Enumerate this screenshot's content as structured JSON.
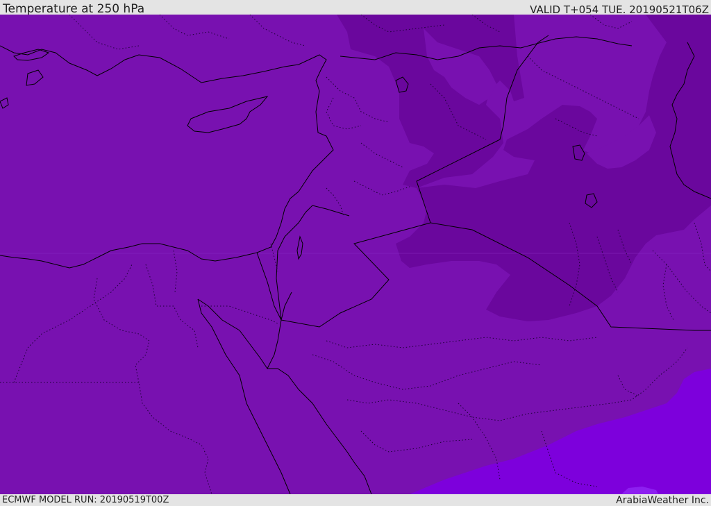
{
  "header": {
    "title": "Temperature at 250 hPa",
    "valid_time": "VALID T+054 TUE. 20190521T06Z"
  },
  "footer": {
    "model_run": "ECMWF MODEL RUN: 20190519T00Z",
    "credit": "ArabiaWeather Inc."
  },
  "map": {
    "fill_colors": {
      "base": "#7811b0",
      "cold_band": "#6a079d",
      "warm_band": "#7d00dc",
      "warm_patch": "#8d1ff0"
    },
    "line_colors": {
      "coast_border": "#000000",
      "admin_border": "#1a0033"
    }
  }
}
